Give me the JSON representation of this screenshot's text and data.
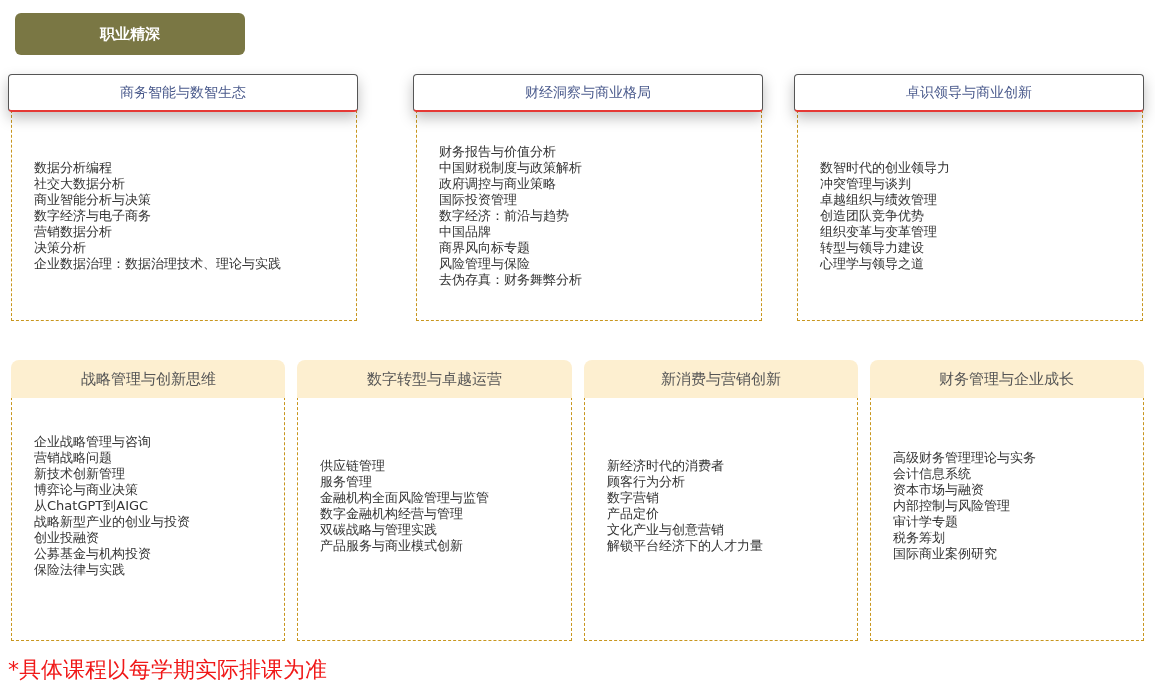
{
  "title": "职业精深",
  "rows": [
    {
      "kind": "outlined",
      "cards": [
        {
          "title": "商务智能与数智生态",
          "courses": [
            "数据分析编程",
            "社交大数据分析",
            "商业智能分析与决策",
            "数字经济与电子商务",
            "营销数据分析",
            "决策分析",
            "企业数据治理：数据治理技术、理论与实践"
          ]
        },
        {
          "title": "财经洞察与商业格局",
          "courses": [
            "财务报告与价值分析",
            "中国财税制度与政策解析",
            "政府调控与商业策略",
            "国际投资管理",
            "数字经济：前沿与趋势",
            "中国品牌",
            "商界风向标专题",
            "风险管理与保险",
            "去伪存真：财务舞弊分析"
          ]
        },
        {
          "title": "卓识领导与商业创新",
          "courses": [
            "数智时代的创业领导力",
            "冲突管理与谈判",
            "卓越组织与绩效管理",
            "创造团队竞争优势",
            "组织变革与变革管理",
            "转型与领导力建设",
            "心理学与领导之道"
          ]
        }
      ]
    },
    {
      "kind": "filled",
      "cards": [
        {
          "title": "战略管理与创新思维",
          "courses": [
            "企业战略管理与咨询",
            "营销战略问题",
            "新技术创新管理",
            "博弈论与商业决策",
            "从ChatGPT到AIGC",
            "战略新型产业的创业与投资",
            "创业投融资",
            "公募基金与机构投资",
            "保险法律与实践"
          ]
        },
        {
          "title": "数字转型与卓越运营",
          "courses": [
            "供应链管理",
            "服务管理",
            "金融机构全面风险管理与监管",
            "数字金融机构经营与管理",
            "双碳战略与管理实践",
            "产品服务与商业模式创新"
          ]
        },
        {
          "title": "新消费与营销创新",
          "courses": [
            "新经济时代的消费者",
            "顾客行为分析",
            "数字营销",
            "产品定价",
            "文化产业与创意营销",
            "解锁平台经济下的人才力量"
          ]
        },
        {
          "title": "财务管理与企业成长",
          "courses": [
            "高级财务管理理论与实务",
            "会计信息系统",
            "资本市场与融资",
            "内部控制与风险管理",
            "审计学专题",
            "税务筹划",
            "国际商业案例研究"
          ]
        }
      ]
    }
  ],
  "footnote": "*具体课程以每学期实际排课为准"
}
